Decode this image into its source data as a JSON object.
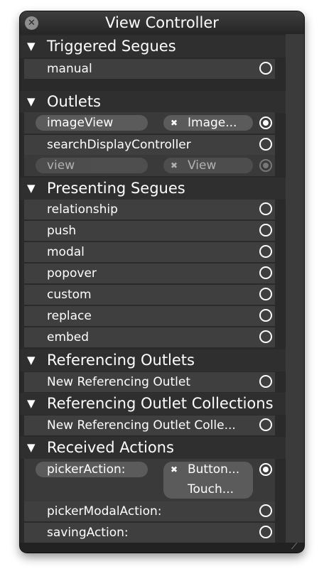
{
  "window": {
    "title": "View Controller"
  },
  "sections": {
    "triggered": {
      "title": "Triggered Segues",
      "rows": [
        "manual"
      ]
    },
    "outlets": {
      "title": "Outlets",
      "rows": [
        {
          "label": "imageView",
          "target": "Image..."
        },
        {
          "label": "searchDisplayController"
        },
        {
          "label": "view",
          "target": "View"
        }
      ]
    },
    "presenting": {
      "title": "Presenting Segues",
      "rows": [
        "relationship",
        "push",
        "modal",
        "popover",
        "custom",
        "replace",
        "embed"
      ]
    },
    "referencing": {
      "title": "Referencing Outlets",
      "rows": [
        "New Referencing Outlet"
      ]
    },
    "collections": {
      "title": "Referencing Outlet Collections",
      "rows": [
        "New Referencing Outlet Colle..."
      ]
    },
    "actions": {
      "title": "Received Actions",
      "rows": [
        {
          "label": "pickerAction:",
          "target1": "Button...",
          "target2": "Touch..."
        },
        {
          "label": "pickerModalAction:"
        },
        {
          "label": "savingAction:"
        }
      ]
    }
  }
}
